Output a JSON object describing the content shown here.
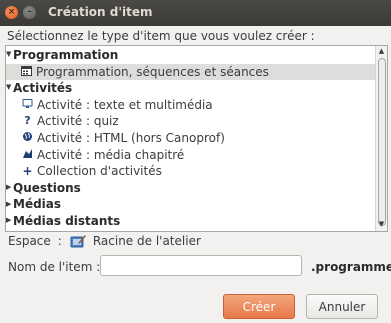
{
  "window": {
    "title": "Création d'item",
    "close_glyph": "×",
    "minimize_glyph": "–"
  },
  "prompt": "Sélectionnez le type d'item que vous voulez créer :",
  "tree": {
    "groups": [
      {
        "label": "Programmation",
        "expanded": true,
        "children": [
          {
            "label": "Programmation, séquences et séances",
            "icon": "calendar-icon",
            "selected": true
          }
        ]
      },
      {
        "label": "Activités",
        "expanded": true,
        "children": [
          {
            "label": "Activité : texte et multimédia",
            "icon": "monitor-icon"
          },
          {
            "label": "Activité : quiz",
            "icon": "question-icon"
          },
          {
            "label": "Activité : HTML (hors Canoprof)",
            "icon": "globe-icon"
          },
          {
            "label": "Activité : média chapitré",
            "icon": "media-icon"
          },
          {
            "label": "Collection d'activités",
            "icon": "plus-icon"
          }
        ]
      },
      {
        "label": "Questions",
        "expanded": false,
        "children": []
      },
      {
        "label": "Médias",
        "expanded": false,
        "children": []
      },
      {
        "label": "Médias distants",
        "expanded": false,
        "children": []
      }
    ],
    "expanded_glyph": "▼",
    "collapsed_glyph": "▶"
  },
  "space": {
    "label": "Espace",
    "separator": ":",
    "value": "Racine de l'atelier",
    "icon": "workshop-icon"
  },
  "name_field": {
    "label": "Nom de l'item :",
    "value": "",
    "placeholder": "",
    "extension": ".programme"
  },
  "buttons": {
    "create": "Créer",
    "cancel": "Annuler"
  },
  "colors": {
    "accent": "#e8784a",
    "titlebar": "#3c3b37",
    "selection": "#dedddb"
  }
}
